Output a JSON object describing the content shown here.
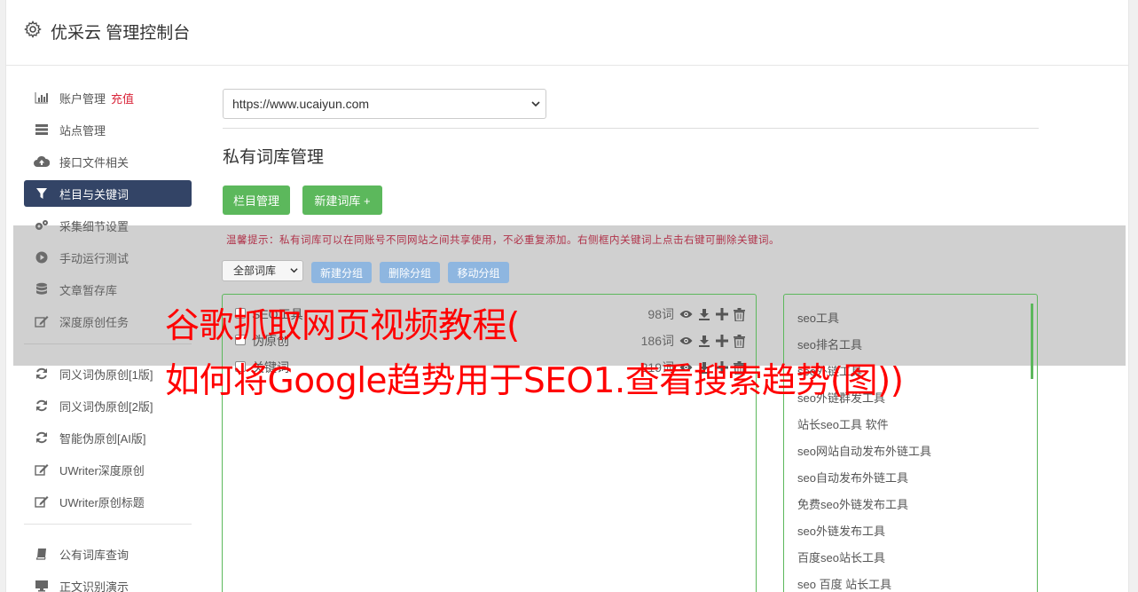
{
  "app": {
    "title": "优采云 管理控制台",
    "gear_icon": "gear-icon"
  },
  "sidebar": {
    "group1": [
      {
        "label": "账户管理",
        "badge": "充值",
        "icon": "bar-chart-icon"
      },
      {
        "label": "站点管理",
        "icon": "server-icon"
      },
      {
        "label": "接口文件相关",
        "icon": "cloud-upload-icon"
      },
      {
        "label": "栏目与关键词",
        "icon": "filter-icon",
        "active": true
      },
      {
        "label": "采集细节设置",
        "icon": "cogs-icon"
      },
      {
        "label": "手动运行测试",
        "icon": "play-circle-icon"
      },
      {
        "label": "文章暂存库",
        "icon": "database-icon"
      },
      {
        "label": "深度原创任务",
        "icon": "edit-icon"
      }
    ],
    "group2": [
      {
        "label": "同义词伪原创[1版]",
        "icon": "refresh-icon"
      },
      {
        "label": "同义词伪原创[2版]",
        "icon": "refresh-icon"
      },
      {
        "label": "智能伪原创[AI版]",
        "icon": "refresh-icon"
      },
      {
        "label": "UWriter深度原创",
        "icon": "edit-icon"
      },
      {
        "label": "UWriter原创标题",
        "icon": "edit-icon"
      }
    ],
    "group3": [
      {
        "label": "公有词库查询",
        "icon": "book-icon"
      },
      {
        "label": "正文识别演示",
        "icon": "monitor-icon"
      }
    ]
  },
  "main": {
    "site_select": "https://www.ucaiyun.com",
    "page_title": "私有词库管理",
    "btn_columns": "栏目管理",
    "btn_new_lib": "新建词库 +",
    "tip": "温馨提示：私有词库可以在同账号不同网站之间共享使用，不必重复添加。右侧框内关键词上点击右键可删除关键词。",
    "lib_select": "全部词库",
    "btn_new_group": "新建分组",
    "btn_delete_group": "删除分组",
    "btn_move_group": "移动分组",
    "libraries": [
      {
        "name": "SEO工具",
        "count": "98词"
      },
      {
        "name": "伪原创",
        "count": "186词"
      },
      {
        "name": "关键词",
        "count": "219词"
      }
    ],
    "keywords": [
      "seo工具",
      "seo排名工具",
      "seo外链工具",
      "seo外链群发工具",
      "站长seo工具 软件",
      "seo网站自动发布外链工具",
      "seo自动发布外链工具",
      "免费seo外链发布工具",
      "seo外链发布工具",
      "百度seo站长工具",
      "seo 百度 站长工具"
    ]
  },
  "overlay": {
    "line1": "谷歌抓取网页视频教程(",
    "line2": "如何将Google趋势用于SEO1.查看搜索趋势(图))"
  },
  "colors": {
    "accent_green": "#5cb85c",
    "active_nav": "#334466",
    "blue_btn": "#8eb6e0",
    "overlay_red": "#ff0000",
    "badge_red": "#d9263b"
  }
}
